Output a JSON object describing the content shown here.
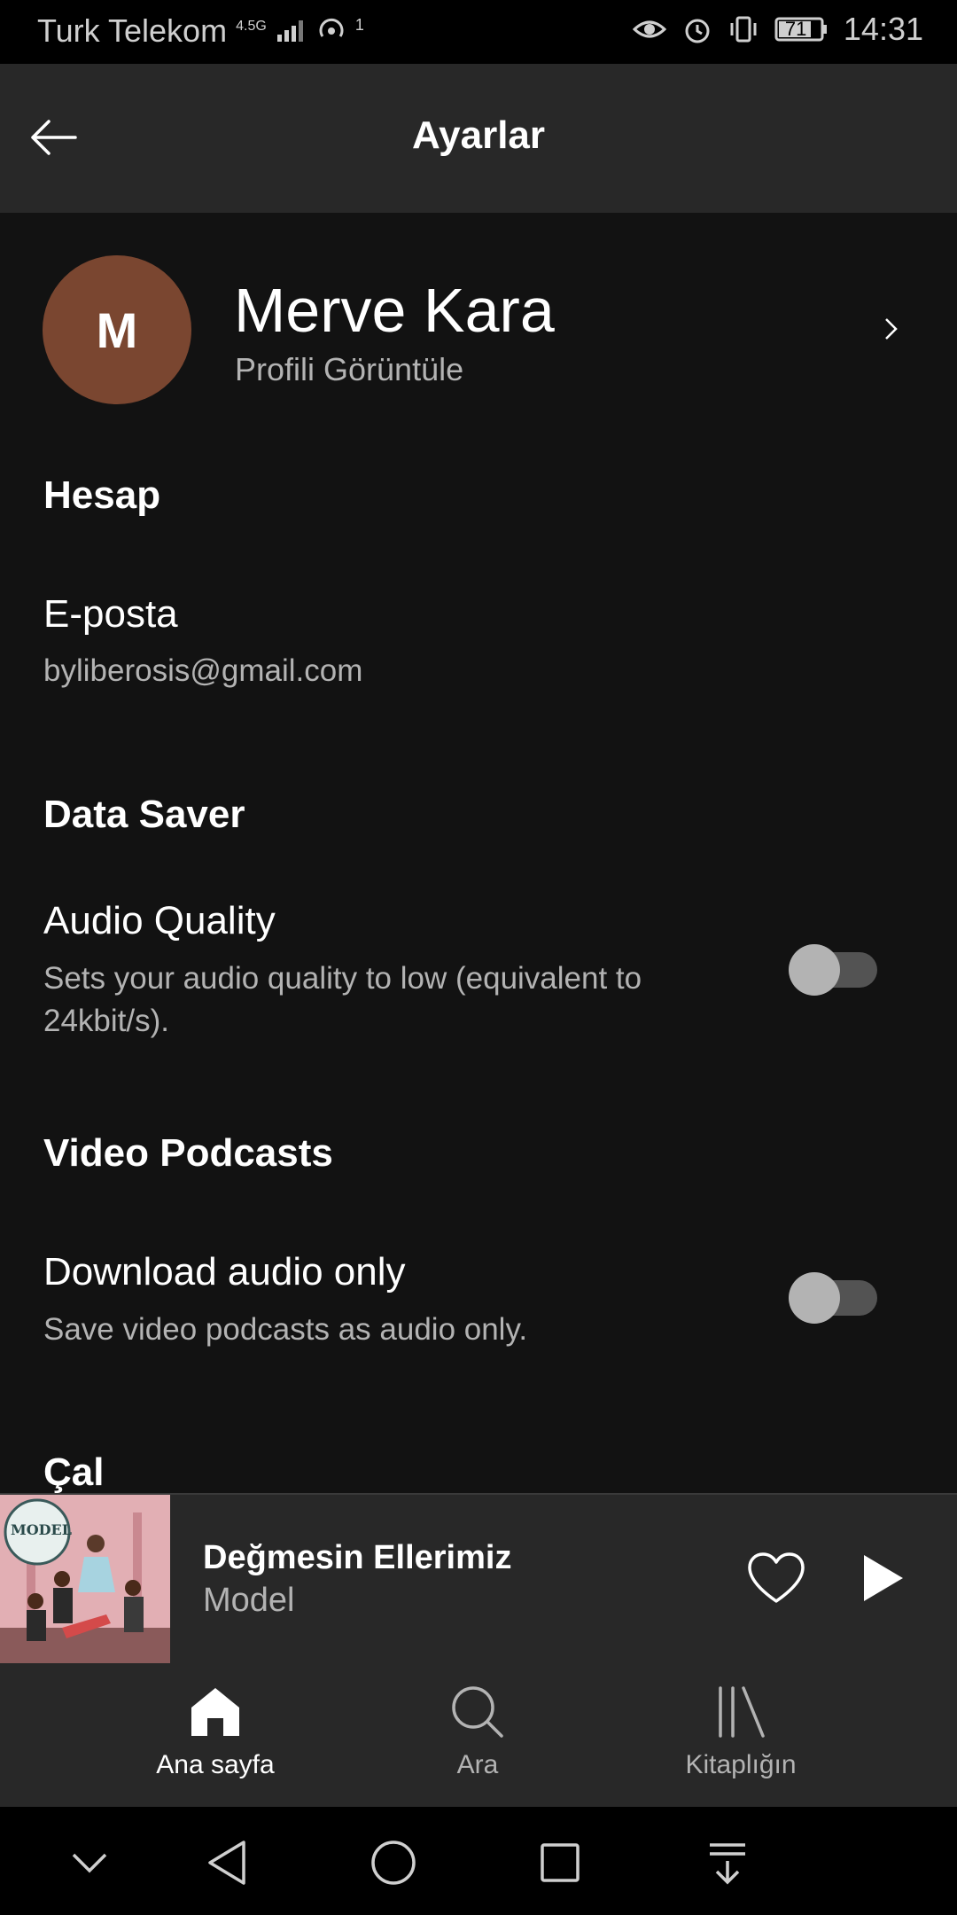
{
  "status_bar": {
    "carrier": "Turk Telekom",
    "network": "4.5G",
    "hotspot_count": "1",
    "battery": "71",
    "time": "14:31"
  },
  "header": {
    "title": "Ayarlar"
  },
  "profile": {
    "initial": "M",
    "name": "Merve Kara",
    "subtitle": "Profili Görüntüle",
    "avatar_color": "#7a4630"
  },
  "sections": {
    "account": {
      "title": "Hesap",
      "email_label": "E-posta",
      "email_value": "byliberosis@gmail.com"
    },
    "data_saver": {
      "title": "Data Saver",
      "audio_quality_label": "Audio Quality",
      "audio_quality_desc_line1": "Sets your audio quality to low (equivalent to",
      "audio_quality_desc_line2": "24kbit/s).",
      "audio_quality_enabled": false
    },
    "video_podcasts": {
      "title": "Video Podcasts",
      "download_label": "Download audio only",
      "download_desc": "Save video podcasts as audio only.",
      "download_enabled": false
    },
    "play": {
      "title": "Çal"
    }
  },
  "mini_player": {
    "song": "Değmesin Ellerimiz",
    "artist": "Model",
    "album_badge": "MODEL"
  },
  "bottom_nav": {
    "items": [
      {
        "label": "Ana sayfa",
        "icon": "home-icon",
        "active": true
      },
      {
        "label": "Ara",
        "icon": "search-icon",
        "active": false
      },
      {
        "label": "Kitaplığın",
        "icon": "library-icon",
        "active": false
      }
    ]
  },
  "colors": {
    "background": "#121212",
    "surface": "#282828",
    "text_secondary": "#b3b3b3",
    "toggle_off_track": "#535353"
  }
}
